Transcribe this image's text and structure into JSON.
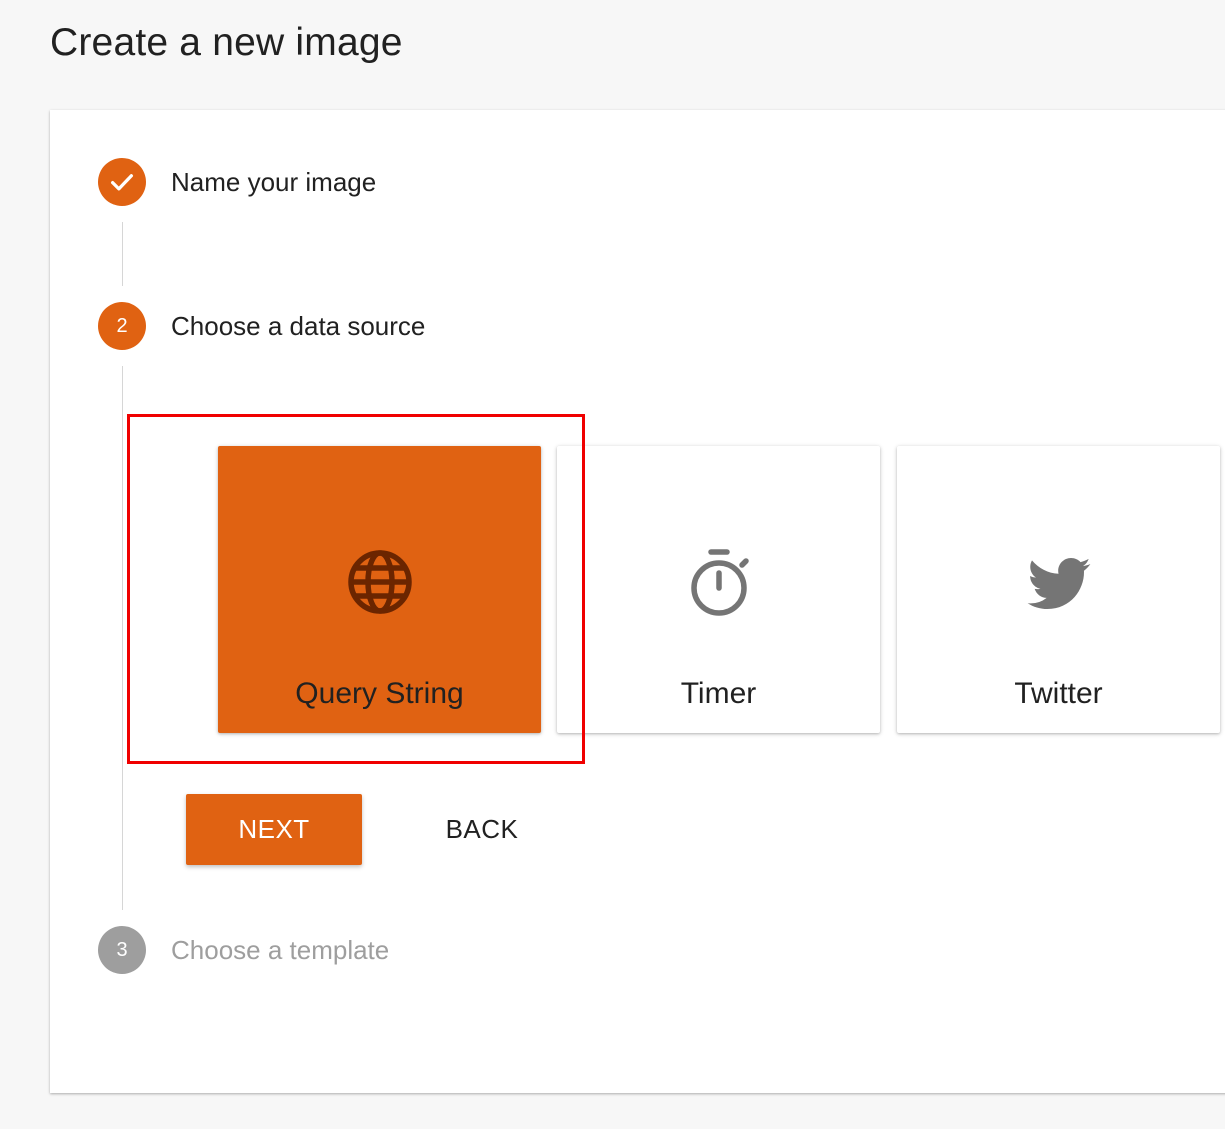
{
  "page": {
    "title": "Create a new image"
  },
  "colors": {
    "accent": "#e06212",
    "pending": "#9e9e9e",
    "highlight": "#f00000"
  },
  "stepper": {
    "steps": [
      {
        "number": "1",
        "label": "Name your image",
        "state": "completed",
        "icon": "check-icon"
      },
      {
        "number": "2",
        "label": "Choose a data source",
        "state": "active"
      },
      {
        "number": "3",
        "label": "Choose a template",
        "state": "pending"
      }
    ]
  },
  "data_sources": {
    "selected": "Query String",
    "options": [
      {
        "label": "Query String",
        "icon": "globe-icon",
        "selected": true
      },
      {
        "label": "Timer",
        "icon": "timer-icon",
        "selected": false
      },
      {
        "label": "Twitter",
        "icon": "twitter-icon",
        "selected": false
      }
    ]
  },
  "actions": {
    "next_label": "NEXT",
    "back_label": "BACK"
  }
}
